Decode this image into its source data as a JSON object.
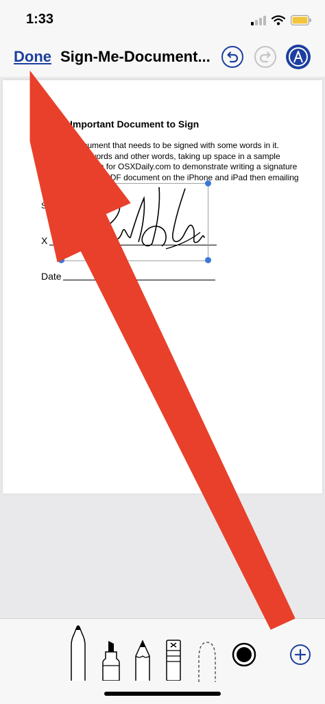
{
  "status": {
    "time": "1:33"
  },
  "nav": {
    "done_label": "Done",
    "title": "Sign-Me-Document..."
  },
  "document": {
    "heading": "Important Document to Sign",
    "body": "This is a document that needs to be signed with some words in it. Words, more words and other words, taking up space in a sample document to sign for OSXDaily.com to demonstrate writing a signature onto an attached PDF document on the iPhone and iPad then emailing it back to someone.",
    "signed_label": "Signed agreement:",
    "sign_prefix": "X",
    "date_label": "Date"
  },
  "colors": {
    "accent": "#1c3fa0",
    "arrow": "#e8402a",
    "handle": "#3a78d8"
  },
  "icons": [
    "undo-icon",
    "redo-icon",
    "markup-icon",
    "pen-icon",
    "marker-icon",
    "pencil-icon",
    "eraser-icon",
    "lasso-icon",
    "color-picker-icon",
    "add-icon"
  ]
}
